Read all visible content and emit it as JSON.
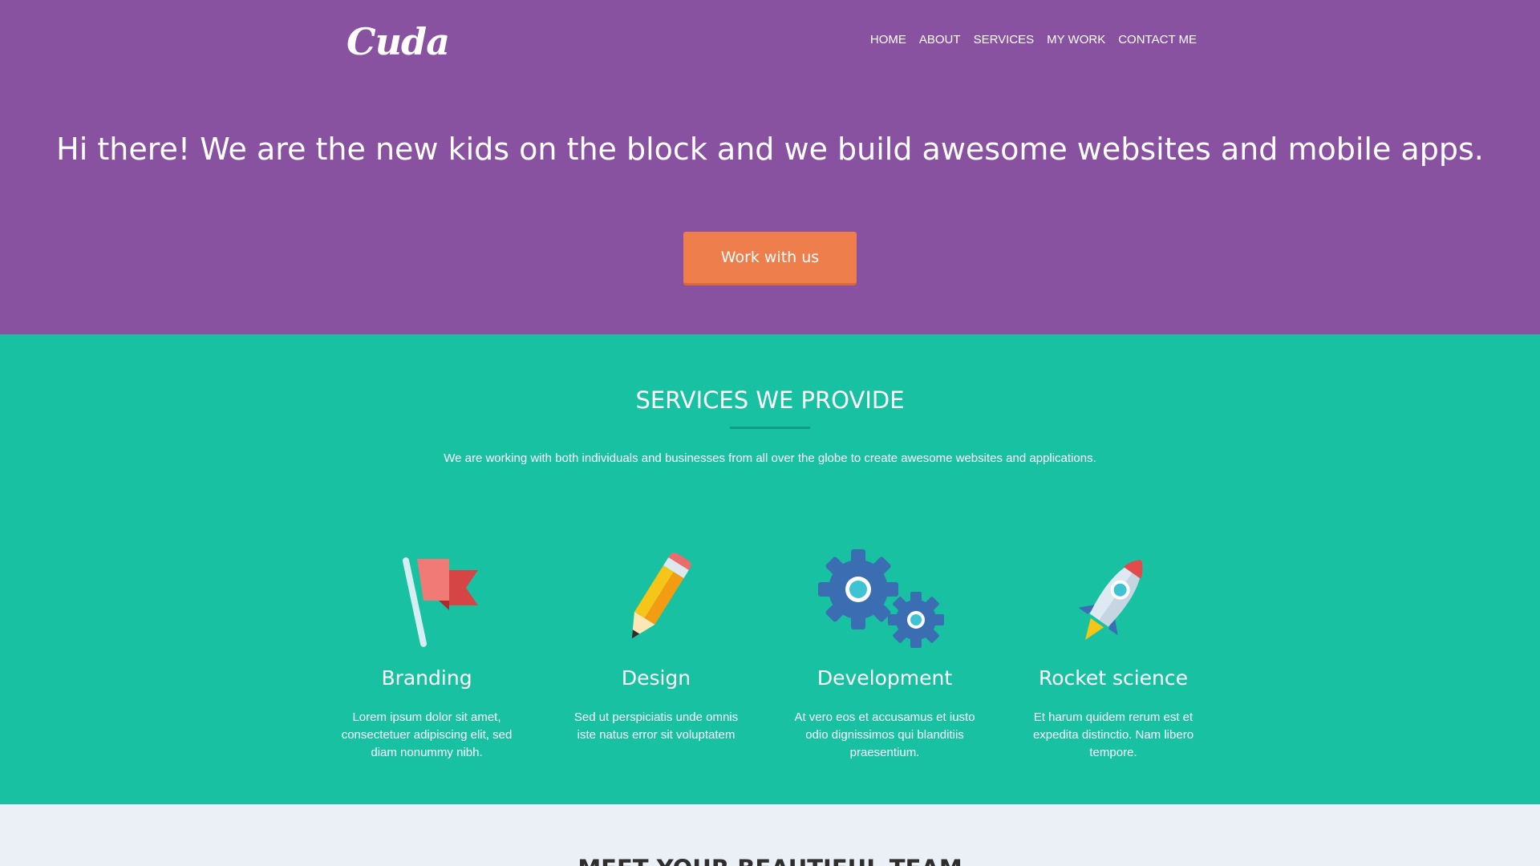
{
  "header": {
    "logo": "Cuda",
    "nav": [
      "HOME",
      "ABOUT",
      "SERVICES",
      "MY WORK",
      "CONTACT ME"
    ]
  },
  "hero": {
    "headline": "Hi there! We are the new kids on the block and we build awesome websites and mobile apps.",
    "cta_label": "Work with us"
  },
  "services": {
    "title": "SERVICES WE PROVIDE",
    "subtitle": "We are working with both individuals and businesses from all over the globe to create awesome websites and applications.",
    "items": [
      {
        "icon": "flag-icon",
        "name": "Branding",
        "desc": "Lorem ipsum dolor sit amet, consectetuer adipiscing elit, sed diam nonummy nibh."
      },
      {
        "icon": "pencil-icon",
        "name": "Design",
        "desc": "Sed ut perspiciatis unde omnis iste natus error sit voluptatem"
      },
      {
        "icon": "gears-icon",
        "name": "Development",
        "desc": "At vero eos et accusamus et iusto odio dignissimos qui blanditiis praesentium."
      },
      {
        "icon": "rocket-icon",
        "name": "Rocket science",
        "desc": "Et harum quidem rerum est et expedita distinctio. Nam libero tempore."
      }
    ]
  },
  "team": {
    "title": "MEET YOUR BEAUTIFUL TEAM"
  },
  "colors": {
    "hero_bg": "#8852a0",
    "services_bg": "#19c1a3",
    "cta_bg": "#ee7f4c",
    "team_bg": "#eaf0f6"
  }
}
